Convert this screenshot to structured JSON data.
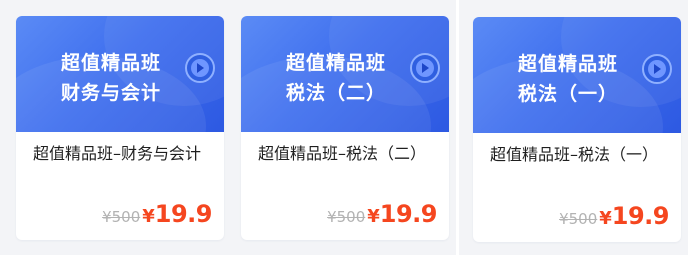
{
  "colors": {
    "banner_blue": "#3f6fee",
    "price_red": "#f5461f",
    "original_price_gray": "#b3b3b3"
  },
  "cards": [
    {
      "banner_line1": "超值精品班",
      "banner_line2": "财务与会计",
      "name": "超值精品班–财务与会计",
      "original_price": "¥500",
      "currency": "¥",
      "sale_price": "19.9"
    },
    {
      "banner_line1": "超值精品班",
      "banner_line2": "税法（二）",
      "name": "超值精品班–税法（二）",
      "original_price": "¥500",
      "currency": "¥",
      "sale_price": "19.9"
    },
    {
      "banner_line1": "超值精品班",
      "banner_line2": "税法（一）",
      "name": "超值精品班–税法（一）",
      "original_price": "¥500",
      "currency": "¥",
      "sale_price": "19.9"
    }
  ]
}
